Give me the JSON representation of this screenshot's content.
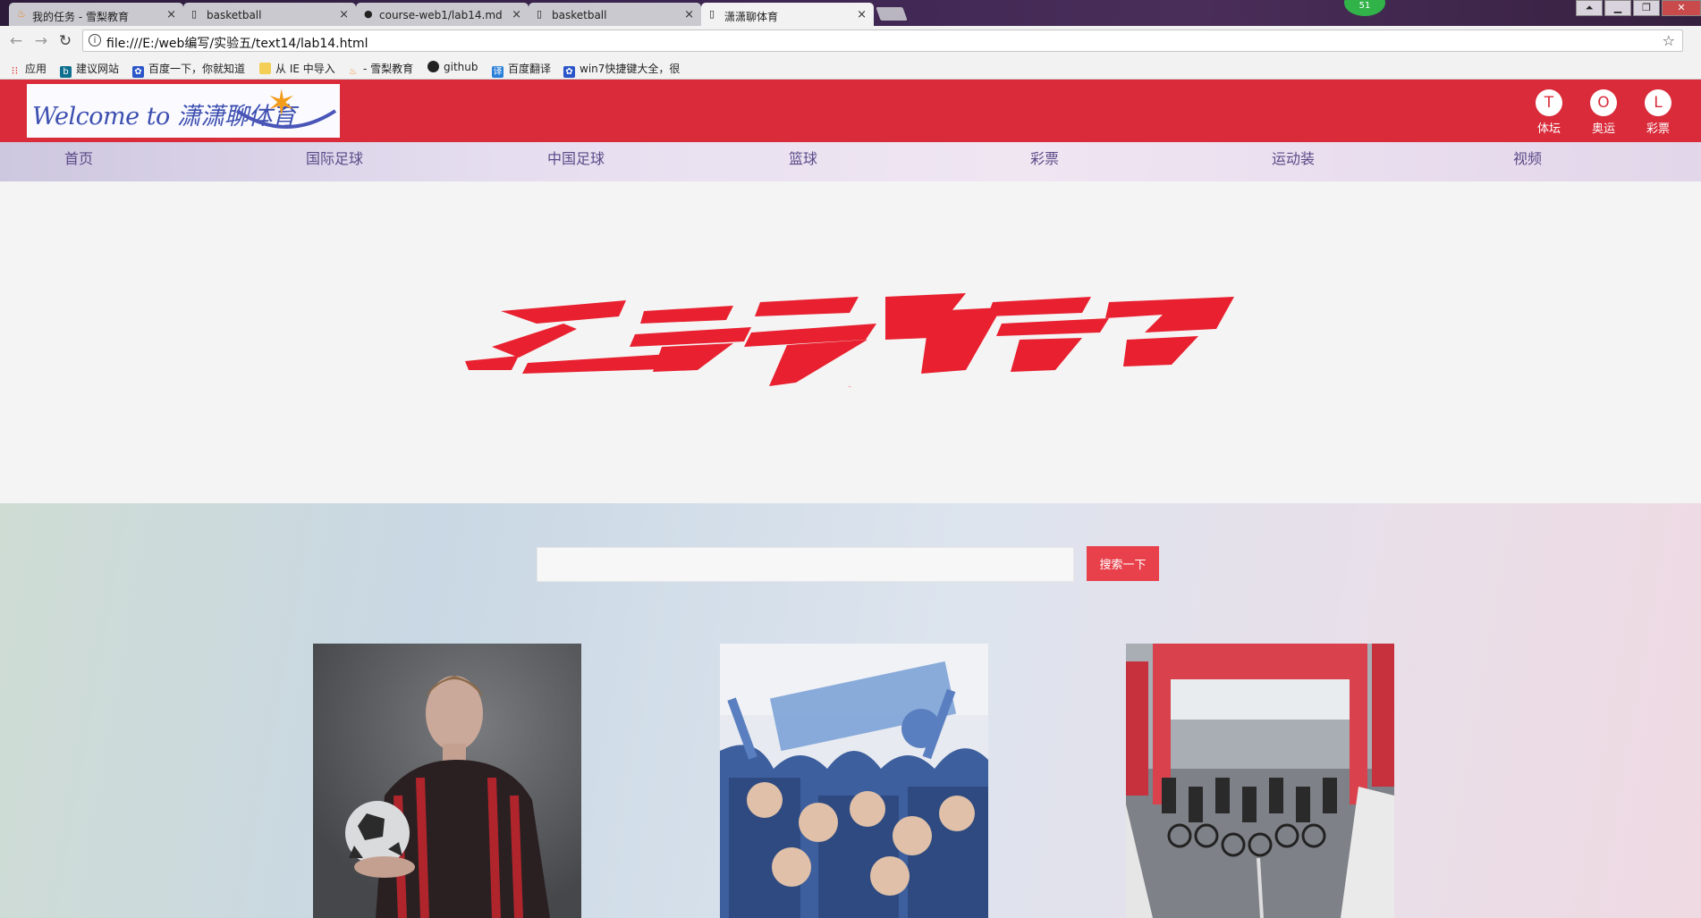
{
  "browser": {
    "tabs": [
      {
        "title": "我的任务 - 雪梨教育"
      },
      {
        "title": "basketball"
      },
      {
        "title": "course-web1/lab14.md"
      },
      {
        "title": "basketball"
      },
      {
        "title": "潇潇聊体育"
      }
    ],
    "close_glyph": "×",
    "url": "file:///E:/web编写/实验五/text14/lab14.html",
    "badge": "51",
    "bookmarks": [
      {
        "label": "应用"
      },
      {
        "label": "建议网站"
      },
      {
        "label": "百度一下，你就知道"
      },
      {
        "label": "从 IE 中导入"
      },
      {
        "label": "- 雪梨教育"
      },
      {
        "label": "github"
      },
      {
        "label": "百度翻译"
      },
      {
        "label": "win7快捷键大全，很"
      }
    ]
  },
  "site": {
    "logo_text": "Welcome to 潇潇聊体育",
    "quick_links": [
      {
        "letter": "T",
        "label": "体坛"
      },
      {
        "letter": "O",
        "label": "奥运"
      },
      {
        "letter": "L",
        "label": "彩票"
      }
    ],
    "nav": [
      {
        "label": "首页"
      },
      {
        "label": "国际足球"
      },
      {
        "label": "中国足球"
      },
      {
        "label": "篮球"
      },
      {
        "label": "彩票"
      },
      {
        "label": "运动装"
      },
      {
        "label": "视频"
      }
    ],
    "hero_title": "运动帮",
    "search": {
      "placeholder": "",
      "button": "搜索一下"
    },
    "cards": [
      {
        "name": "soccer-player"
      },
      {
        "name": "fans-crowd"
      },
      {
        "name": "cycling-race"
      }
    ]
  },
  "colors": {
    "header_red": "#d92b3a",
    "hero_red": "#e8202f",
    "nav_text": "#5a4a88",
    "search_button": "#e8414b"
  }
}
